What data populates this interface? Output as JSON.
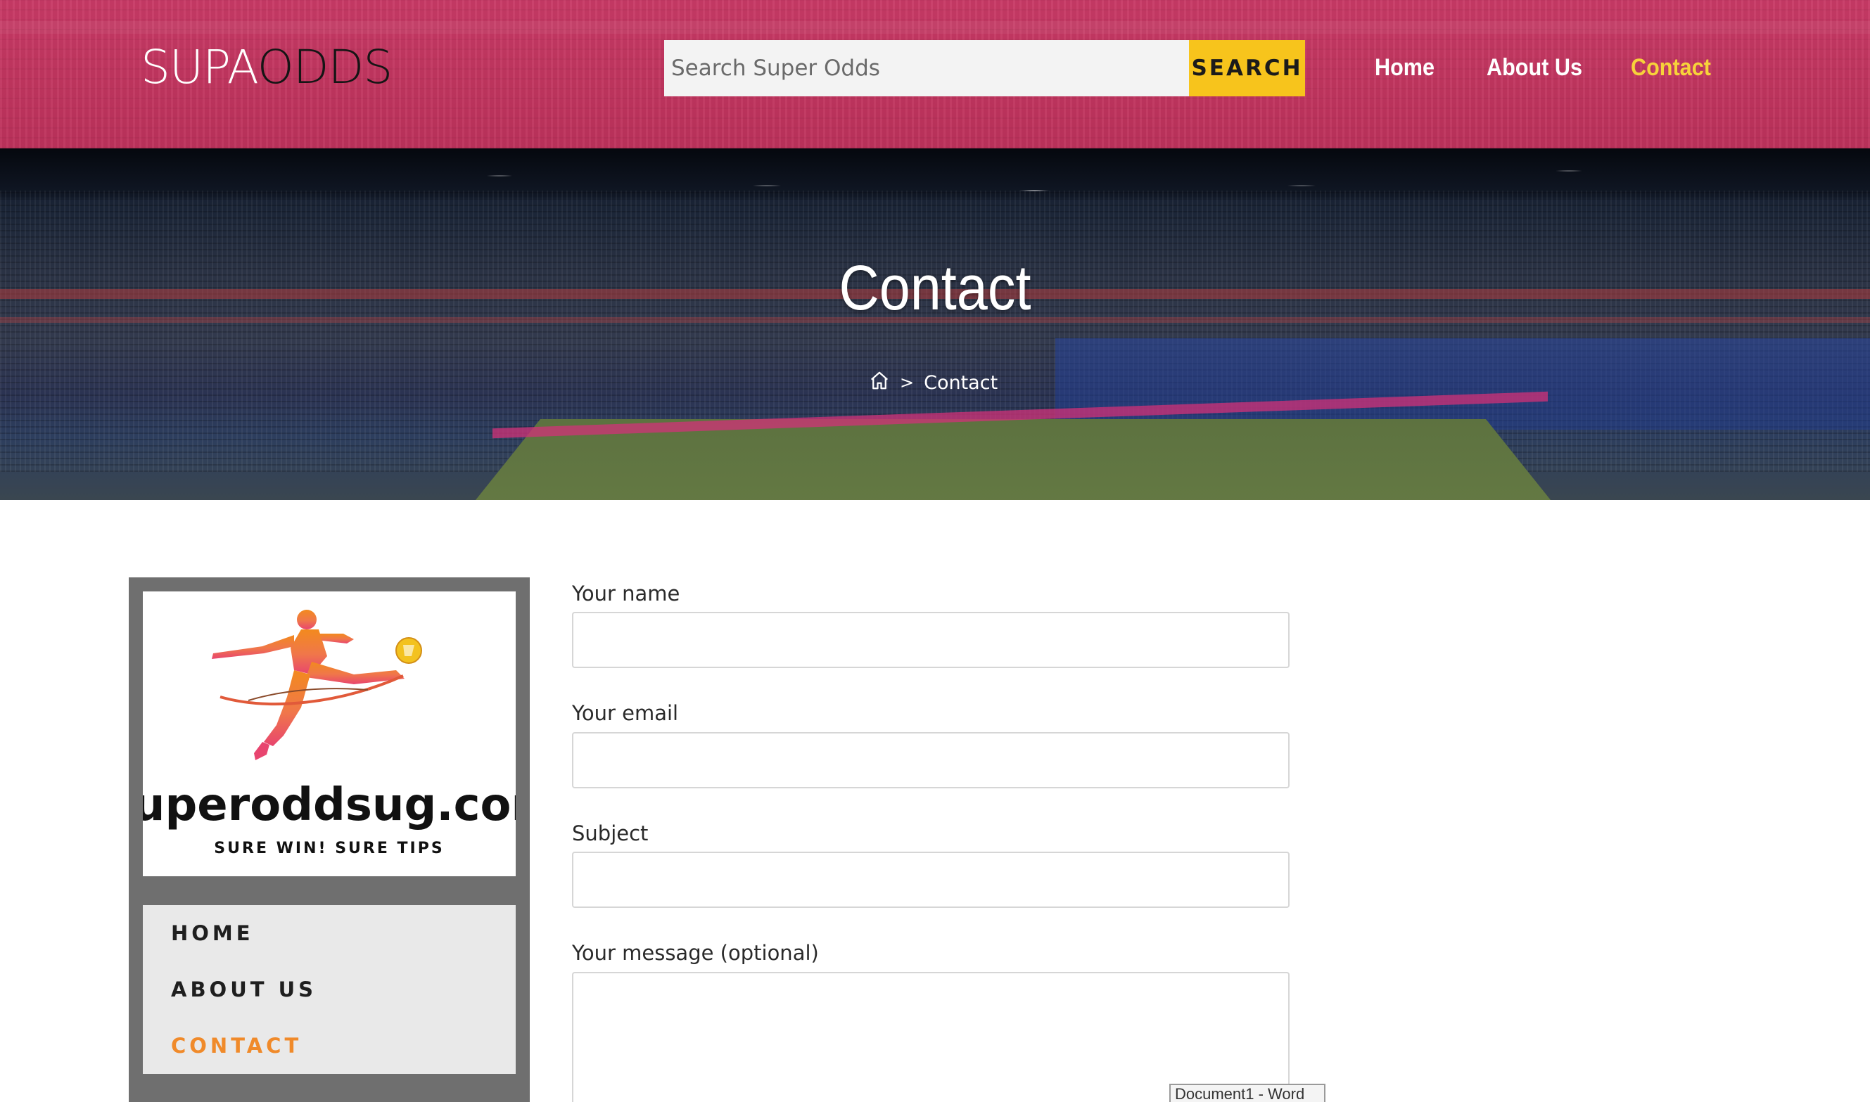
{
  "header": {
    "logo_part1": "SUPA",
    "logo_part2": "ODDS",
    "search_placeholder": "Search Super Odds",
    "search_button_label": "SEARCH",
    "nav": [
      {
        "label": "Home"
      },
      {
        "label": "About Us"
      },
      {
        "label": "Contact",
        "active": true
      }
    ]
  },
  "hero": {
    "title": "Contact",
    "breadcrumb_current": "Contact",
    "breadcrumb_separator": ">"
  },
  "sidebar": {
    "logo_title": "Superoddsug.com",
    "logo_tagline": "SURE WIN! SURE TIPS",
    "menu": [
      {
        "label": "HOME"
      },
      {
        "label": "ABOUT US"
      },
      {
        "label": "CONTACT",
        "active": true
      }
    ]
  },
  "form": {
    "name_label": "Your name",
    "name_value": "",
    "email_label": "Your email",
    "email_value": "",
    "subject_label": "Subject",
    "subject_value": "",
    "message_label": "Your message (optional)",
    "message_value": ""
  },
  "tooltip": {
    "text": "Document1 - Word"
  },
  "colors": {
    "header_bg": "#c23660",
    "search_button": "#f7c41c",
    "nav_active": "#f7d23a",
    "sidebar_bg": "#6f6f6f",
    "sidebar_menu_bg": "#e9e9e9",
    "sidebar_active": "#f08a2a"
  }
}
